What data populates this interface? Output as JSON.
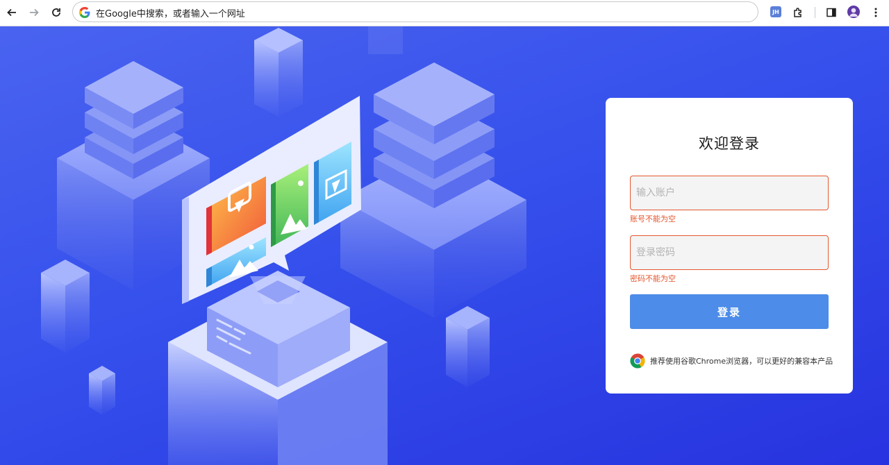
{
  "browser": {
    "omnibox_placeholder": "在Google中搜索，或者输入一个网址",
    "extension_badge": "JH",
    "icons": [
      "back-icon",
      "forward-icon",
      "reload-icon",
      "google-g-icon",
      "extensions-icon",
      "side-panel-icon",
      "profile-avatar",
      "more-menu-icon"
    ]
  },
  "login": {
    "title": "欢迎登录",
    "account_placeholder": "输入账户",
    "account_error": "账号不能为空",
    "password_placeholder": "登录密码",
    "password_error": "密码不能为空",
    "submit_label": "登录",
    "browser_tip": "推荐使用谷歌Chrome浏览器，可以更好的兼容本产品"
  },
  "colors": {
    "page_background": "#3550ec",
    "error": "#e4572e",
    "button": "#4d8ce8",
    "card": "#ffffff"
  }
}
